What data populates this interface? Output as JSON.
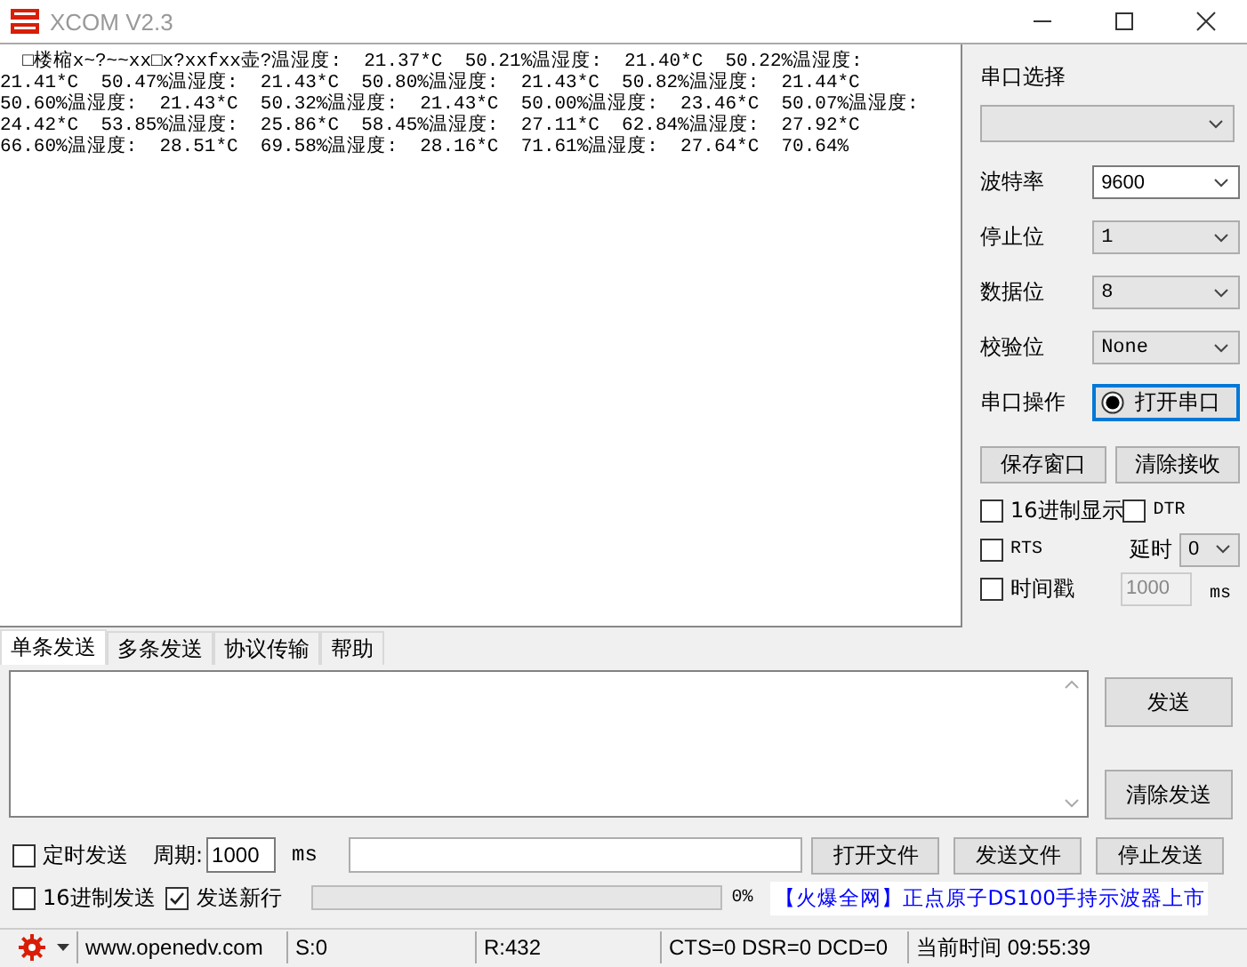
{
  "window": {
    "title": "XCOM V2.3"
  },
  "receive_lines": [
    "  □楼樎x~?~~xx□x?xxfxx壶?温湿度:  21.37*C  50.21%温湿度:  21.40*C  50.22%温湿度:",
    "21.41*C  50.47%温湿度:  21.43*C  50.80%温湿度:  21.43*C  50.82%温湿度:  21.44*C",
    "50.60%温湿度:  21.43*C  50.32%温湿度:  21.43*C  50.00%温湿度:  23.46*C  50.07%温湿度:",
    "24.42*C  53.85%温湿度:  25.86*C  58.45%温湿度:  27.11*C  62.84%温湿度:  27.92*C",
    "66.60%温湿度:  28.51*C  69.58%温湿度:  28.16*C  71.61%温湿度:  27.64*C  70.64%"
  ],
  "port_select": {
    "label": "串口选择"
  },
  "settings": [
    {
      "label": "波特率",
      "value": "9600",
      "kind": "editable"
    },
    {
      "label": "停止位",
      "value": "1",
      "kind": "list"
    },
    {
      "label": "数据位",
      "value": "8",
      "kind": "list"
    },
    {
      "label": "校验位",
      "value": "None",
      "kind": "list"
    }
  ],
  "port_operation": {
    "label": "串口操作",
    "button": "打开串口"
  },
  "panel_buttons": [
    "保存窗口",
    "清除接收"
  ],
  "hex_display": {
    "label": "16进制显示",
    "checked": false
  },
  "dtr": {
    "label": "DTR",
    "checked": false
  },
  "rts": {
    "label": "RTS",
    "checked": false
  },
  "delay": {
    "label": "延时",
    "value": "0"
  },
  "timestamp": {
    "label": "时间戳",
    "checked": false,
    "interval": "1000",
    "unit": "ms"
  },
  "tabs": [
    {
      "label": "单条发送",
      "selected": true
    },
    {
      "label": "多条发送",
      "selected": false
    },
    {
      "label": "协议传输",
      "selected": false
    },
    {
      "label": "帮助",
      "selected": false
    }
  ],
  "send_buttons": [
    "发送",
    "清除发送"
  ],
  "timer": {
    "label": "定时发送",
    "checked": false,
    "period_label": "周期:",
    "period": "1000",
    "unit": "ms"
  },
  "hex_send": {
    "label": "16进制发送",
    "checked": false
  },
  "newline": {
    "label": "发送新行",
    "checked": true
  },
  "file_buttons": [
    "打开文件",
    "发送文件",
    "停止发送"
  ],
  "progress": {
    "level": 0,
    "reading": "0%"
  },
  "ad": "【火爆全网】正点原子DS100手持示波器上市",
  "status_bar": {
    "website": "www.openedv.com",
    "sent": "S:0",
    "received": "R:432",
    "lines": "CTS=0 DSR=0 DCD=0",
    "time": "当前时间 09:55:39"
  }
}
